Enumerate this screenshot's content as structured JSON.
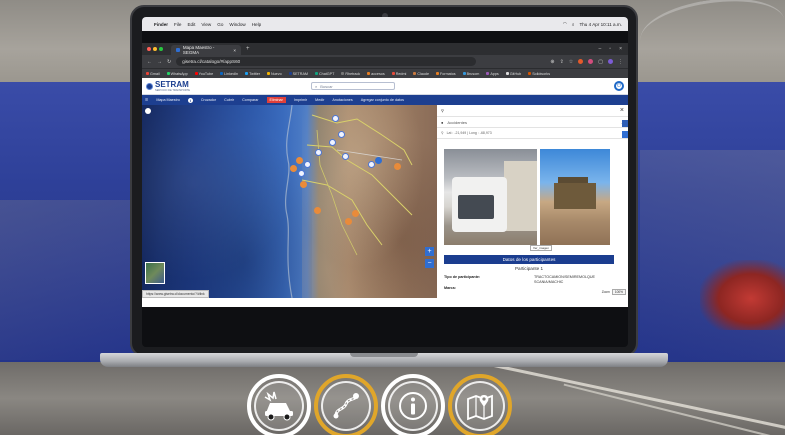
{
  "menubar": {
    "app": "Finder",
    "items": [
      "File",
      "Edit",
      "View",
      "Go",
      "Window",
      "Help"
    ],
    "clock": "Thu 4 Apr  10:11 a.m."
  },
  "browser": {
    "tab_title": "Mapa Maestro - SEGMA",
    "url": "gisetra.cl/catalogo/#/appS60",
    "bookmarks": [
      "Gmail",
      "WhatsApp",
      "YouTube",
      "LinkedIn",
      "Twitter",
      "Nuevo",
      "SETRAM",
      "ChatGPT",
      "Rhetrack",
      "accesos",
      "Redmi",
      "Claude",
      "Formatos",
      "Brusom",
      "Apps",
      "GitHub",
      "Solidworks"
    ]
  },
  "app": {
    "logo": "SETRAM",
    "logo_sub": "SERVICIO DE TRANSPORTE",
    "search_placeholder": "Buscar",
    "nav": {
      "menu": "Mapa Maestro",
      "items": [
        "Cruzador",
        "Cubrir",
        "Comparar",
        "Medir",
        "Imprimir",
        "Medir",
        "Anotaciones",
        "Agregar conjunto de datos"
      ],
      "active_label": "Eliminar"
    }
  },
  "map": {
    "zoom_in": "+",
    "zoom_out": "−",
    "status_url": "https://www.gisetra.cl/documento/?/#link"
  },
  "panel": {
    "layer_select": "Accidentes",
    "coords": "Lat : -21,949  |  Long : -68,973",
    "photo_caption": "Ver_imagen",
    "participants_header": "Datos de los participantes",
    "participant_title": "Participante 1",
    "fields": [
      {
        "label": "Tipo de participante:",
        "value": "TRACTOCAMION/SEMIREMOLQUE"
      },
      {
        "label": "",
        "value": "SCANIA/MACHIC"
      },
      {
        "label": "Marca:",
        "value": ""
      }
    ],
    "zoom_label": "Zoom",
    "zoom_value": "100%"
  },
  "actions": {
    "icons": [
      "crash-car-icon",
      "route-map-icon",
      "info-icon",
      "location-map-icon"
    ]
  },
  "colors": {
    "accent_blue": "#1d3f90",
    "alert_red": "#e0403a",
    "ring_gold": "#e0a62a"
  }
}
